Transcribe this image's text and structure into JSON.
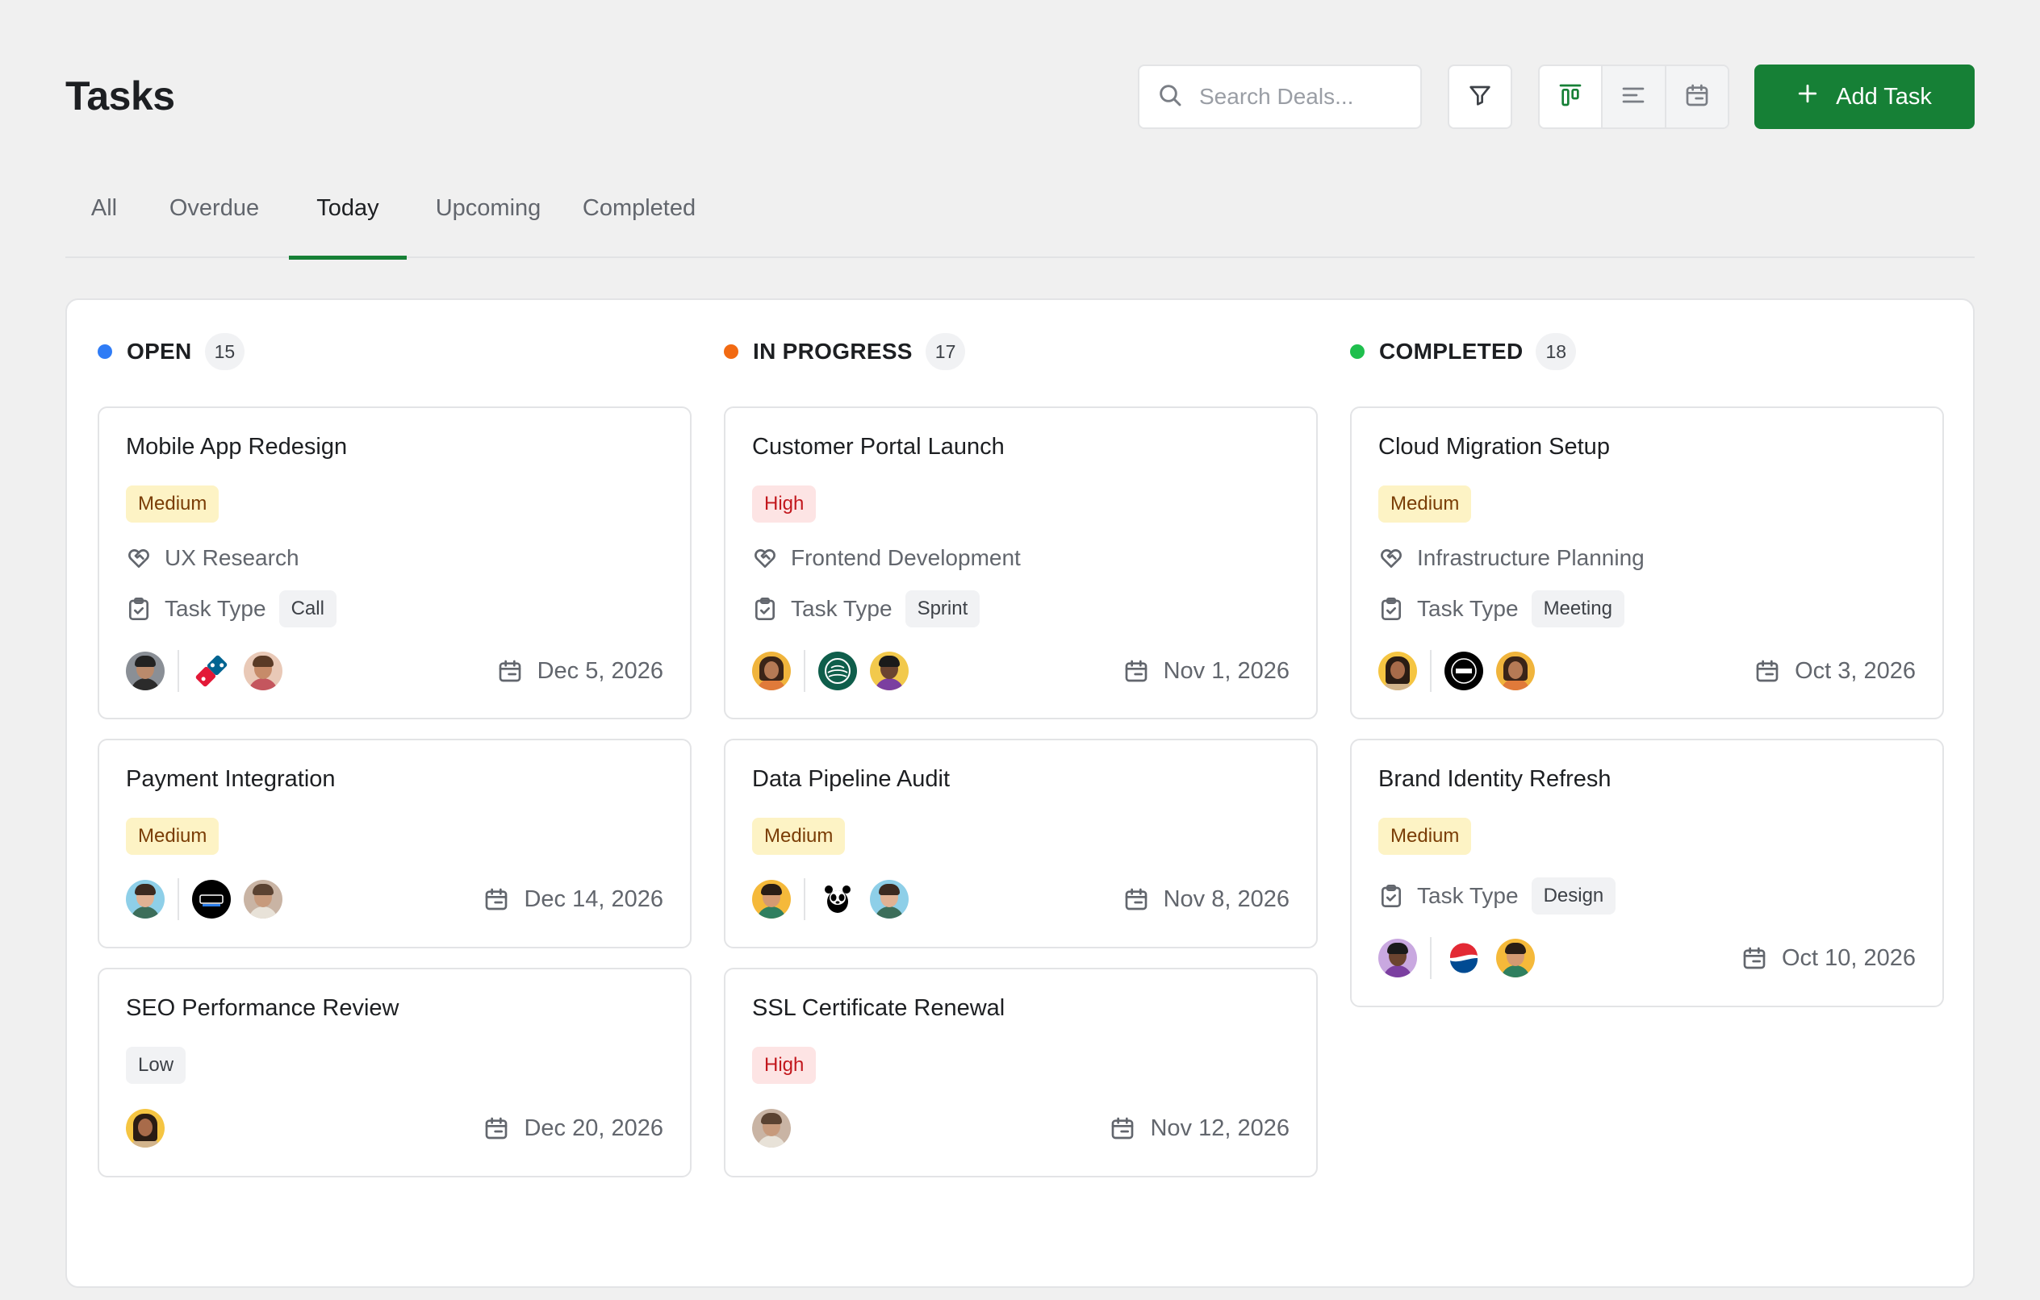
{
  "page": {
    "title": "Tasks"
  },
  "toolbar": {
    "search_placeholder": "Search Deals...",
    "search_icon": "search-icon",
    "filter_icon": "filter-icon",
    "views": [
      {
        "icon": "board-view-icon",
        "active": true
      },
      {
        "icon": "list-view-icon",
        "active": false
      },
      {
        "icon": "calendar-view-icon",
        "active": false
      }
    ],
    "add_label": "Add Task"
  },
  "tabs": [
    {
      "label": "All",
      "active": false
    },
    {
      "label": "Overdue",
      "active": false
    },
    {
      "label": "Today",
      "active": true
    },
    {
      "label": "Upcoming",
      "active": false
    },
    {
      "label": "Completed",
      "active": false
    }
  ],
  "colors": {
    "accent": "#168036",
    "open": "#2f7cf6",
    "in_progress": "#f26a12",
    "completed": "#1fbf4d"
  },
  "columns": [
    {
      "title": "OPEN",
      "count": "15",
      "cards": [
        {
          "title": "Mobile App Redesign",
          "priority": "Medium",
          "project": "UX Research",
          "task_type_label": "Task Type",
          "task_type": "Call",
          "date": "Dec 5, 2026"
        },
        {
          "title": "Payment Integration",
          "priority": "Medium",
          "date": "Dec 14, 2026"
        },
        {
          "title": "SEO Performance Review",
          "priority": "Low",
          "date": "Dec 20, 2026"
        }
      ]
    },
    {
      "title": "IN PROGRESS",
      "count": "17",
      "cards": [
        {
          "title": "Customer Portal Launch",
          "priority": "High",
          "project": "Frontend Development",
          "task_type_label": "Task Type",
          "task_type": "Sprint",
          "date": "Nov 1, 2026"
        },
        {
          "title": "Data Pipeline Audit",
          "priority": "Medium",
          "date": "Nov 8, 2026"
        },
        {
          "title": "SSL Certificate Renewal",
          "priority": "High",
          "date": "Nov 12, 2026"
        }
      ]
    },
    {
      "title": "COMPLETED",
      "count": "18",
      "cards": [
        {
          "title": "Cloud Migration Setup",
          "priority": "Medium",
          "project": "Infrastructure Planning",
          "task_type_label": "Task Type",
          "task_type": "Meeting",
          "date": "Oct 3, 2026"
        },
        {
          "title": "Brand Identity Refresh",
          "priority": "Medium",
          "task_type_label": "Task Type",
          "task_type": "Design",
          "date": "Oct 10, 2026"
        }
      ]
    }
  ]
}
